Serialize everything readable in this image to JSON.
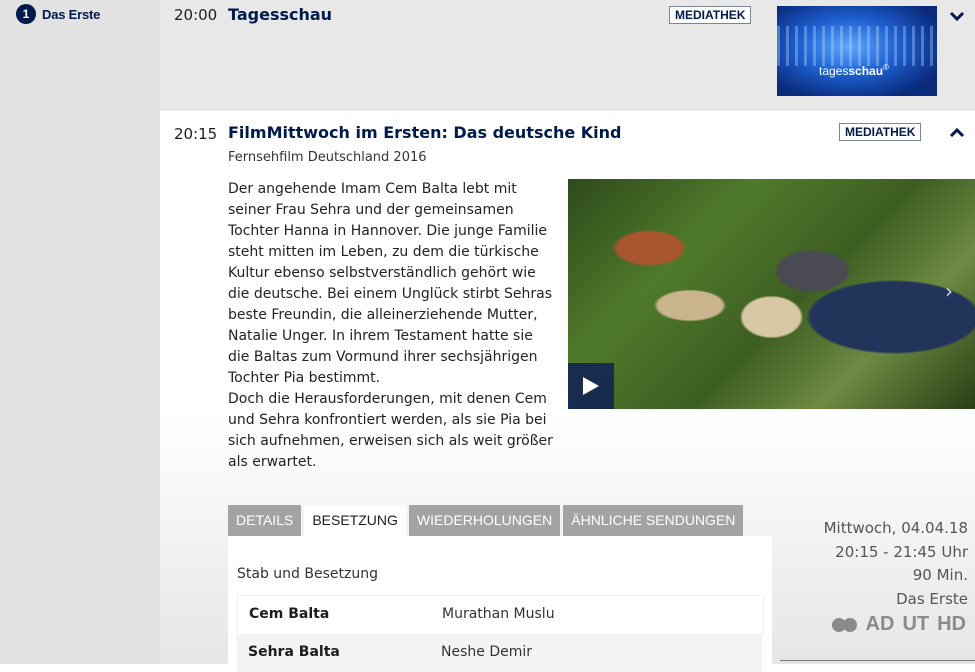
{
  "sidebar": {
    "brand_logo": "1",
    "brand_name": "Das Erste"
  },
  "programs": [
    {
      "time": "20:00",
      "title": "Tagesschau",
      "badge": "MEDIATHEK",
      "thumb_label_plain": "tages",
      "thumb_label_bold": "schau",
      "thumb_reg": "®"
    },
    {
      "time": "20:15",
      "title": "FilmMittwoch im Ersten: Das deutsche Kind",
      "badge": "MEDIATHEK",
      "subtitle": "Fernsehfilm Deutschland 2016",
      "description": "Der angehende Imam Cem Balta lebt mit seiner Frau Sehra und der gemeinsamen Tochter Hanna in Hannover. Die junge Familie steht mitten im Leben, zu dem die türkische Kultur ebenso selbstverständlich gehört wie die deutsche. Bei einem Unglück stirbt Sehras beste Freundin, die alleinerziehende Mutter, Natalie Unger. In ihrem Testament hatte sie die Baltas zum Vormund ihrer sechsjährigen Tochter Pia bestimmt.\nDoch die Herausforderungen, mit denen Cem und Sehra konfrontiert werden, als sie Pia bei sich aufnehmen, erweisen sich als weit größer als erwartet.",
      "tabs": [
        "DETAILS",
        "BESETZUNG",
        "WIEDERHOLUNGEN",
        "ÄHNLICHE SENDUNGEN"
      ],
      "active_tab": "BESETZUNG",
      "panel_title": "Stab und Besetzung",
      "cast": [
        {
          "role": "Cem Balta",
          "actor": "Murathan Muslu"
        },
        {
          "role": "Sehra Balta",
          "actor": "Neshe Demir"
        }
      ],
      "meta": {
        "date": "Mittwoch, 04.04.18",
        "time_range": "20:15 - 21:45 Uhr",
        "duration": "90 Min.",
        "channel": "Das Erste"
      },
      "access": {
        "ad": "AD",
        "ut": "UT",
        "hd": "HD"
      }
    }
  ],
  "colors": {
    "brand_blue": "#001a4b",
    "tab_inactive": "#a3a3a3",
    "row_bg": "#e8e8e8"
  }
}
